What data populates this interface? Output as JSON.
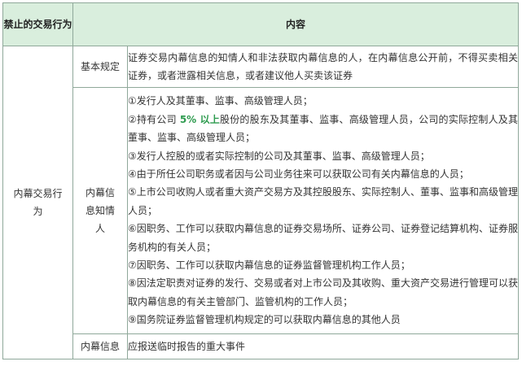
{
  "header": {
    "col1": "禁止的交易行为",
    "col2": "内容"
  },
  "section": {
    "label": "内幕交易行为",
    "basic": {
      "label": "基本规定",
      "text": "证券交易内幕信息的知情人和非法获取内幕信息的人，在内幕信息公开前，不得买卖相关证券，或者泄露相关信息，或者建议他人买卖该证券"
    },
    "insiders": {
      "label": "内幕信息知情人",
      "items": [
        "①发行人及其董事、监事、高级管理人员；",
        {
          "pre": "②持有公司 ",
          "highlight": "5% 以上",
          "post": "股份的股东及其董事、监事、高级管理人员，公司的实际控制人及其董事、监事、高级管理人员；"
        },
        "③发行人控股的或者实际控制的公司及其董事、监事、高级管理人员；",
        "④由于所任公司职务或者因与公司业务往来可以获取公司有关内幕信息的人员；",
        "⑤上市公司收购人或者重大资产交易方及其控股股东、实际控制人、董事、监事和高级管理人员；",
        "⑥因职务、工作可以获取内幕信息的证券交易场所、证券公司、证券登记结算机构、证券服务机构的有关人员；",
        "⑦因职务、工作可以获取内幕信息的证券监督管理机构工作人员；",
        "⑧因法定职责对证券的发行、交易或者对上市公司及其收购、重大资产交易进行管理可以获取内幕信息的有关主管部门、监管机构的工作人员；",
        "⑨国务院证券监督管理机构规定的可以获取内幕信息的其他人员"
      ]
    },
    "info": {
      "label": "内幕信息",
      "text": "应报送临时报告的重大事件"
    }
  },
  "colors": {
    "header_bg": "#d9eedd",
    "border": "#8fa89a",
    "highlight": "#2e9b4f"
  }
}
